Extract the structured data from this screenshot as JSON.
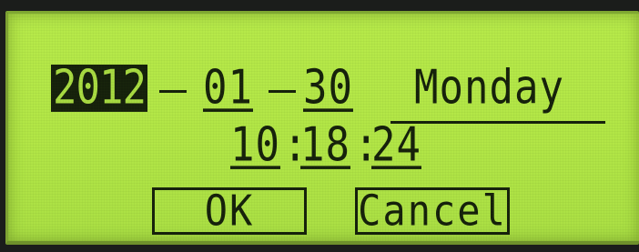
{
  "date": {
    "year": "2012",
    "separator": "—",
    "month": "01",
    "day": "30",
    "weekday": "Monday"
  },
  "time": {
    "hour": "10",
    "minute": "18",
    "second": "24",
    "separator": ":"
  },
  "buttons": {
    "ok_label": "OK",
    "cancel_label": "Cancel"
  },
  "colors": {
    "lcd_background": "#b2e646",
    "lcd_foreground": "#15200b",
    "bezel": "#1b1d1b"
  }
}
